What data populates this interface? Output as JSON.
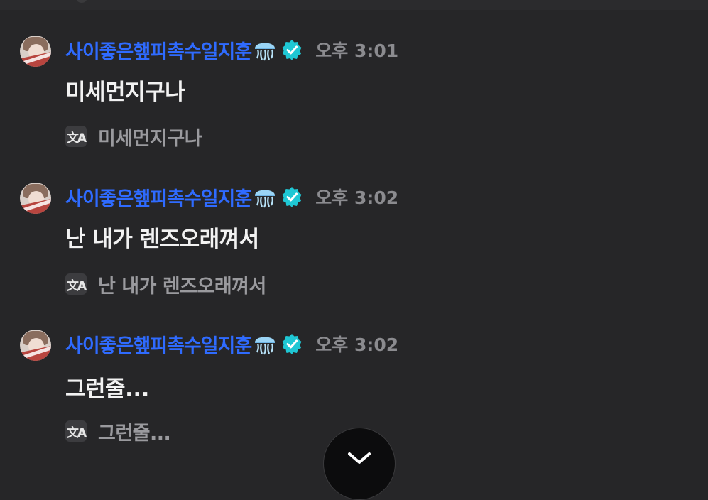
{
  "messages": [
    {
      "username": "사이좋은햎피촉수일지훈",
      "time": "오후 3:01",
      "text": "미세먼지구나",
      "translation": "미세먼지구나"
    },
    {
      "username": "사이좋은햎피촉수일지훈",
      "time": "오후 3:02",
      "text": "난 내가 렌즈오래껴서",
      "translation": "난 내가 렌즈오래껴서"
    },
    {
      "username": "사이좋은햎피촉수일지훈",
      "time": "오후 3:02",
      "text": "그런줄...",
      "translation": "그런줄..."
    }
  ],
  "icons": {
    "emoji": "jellyfish-icon",
    "badge": "verified-badge-icon",
    "translate": "translate-icon",
    "translate_glyph": "文A",
    "scroll": "chevron-down-icon"
  },
  "colors": {
    "background": "#262628",
    "username": "#2f6bff",
    "verified": "#1fc7d4",
    "time": "#8b8b8f",
    "text": "#f2f2f2",
    "translation": "#9a9a9e"
  }
}
